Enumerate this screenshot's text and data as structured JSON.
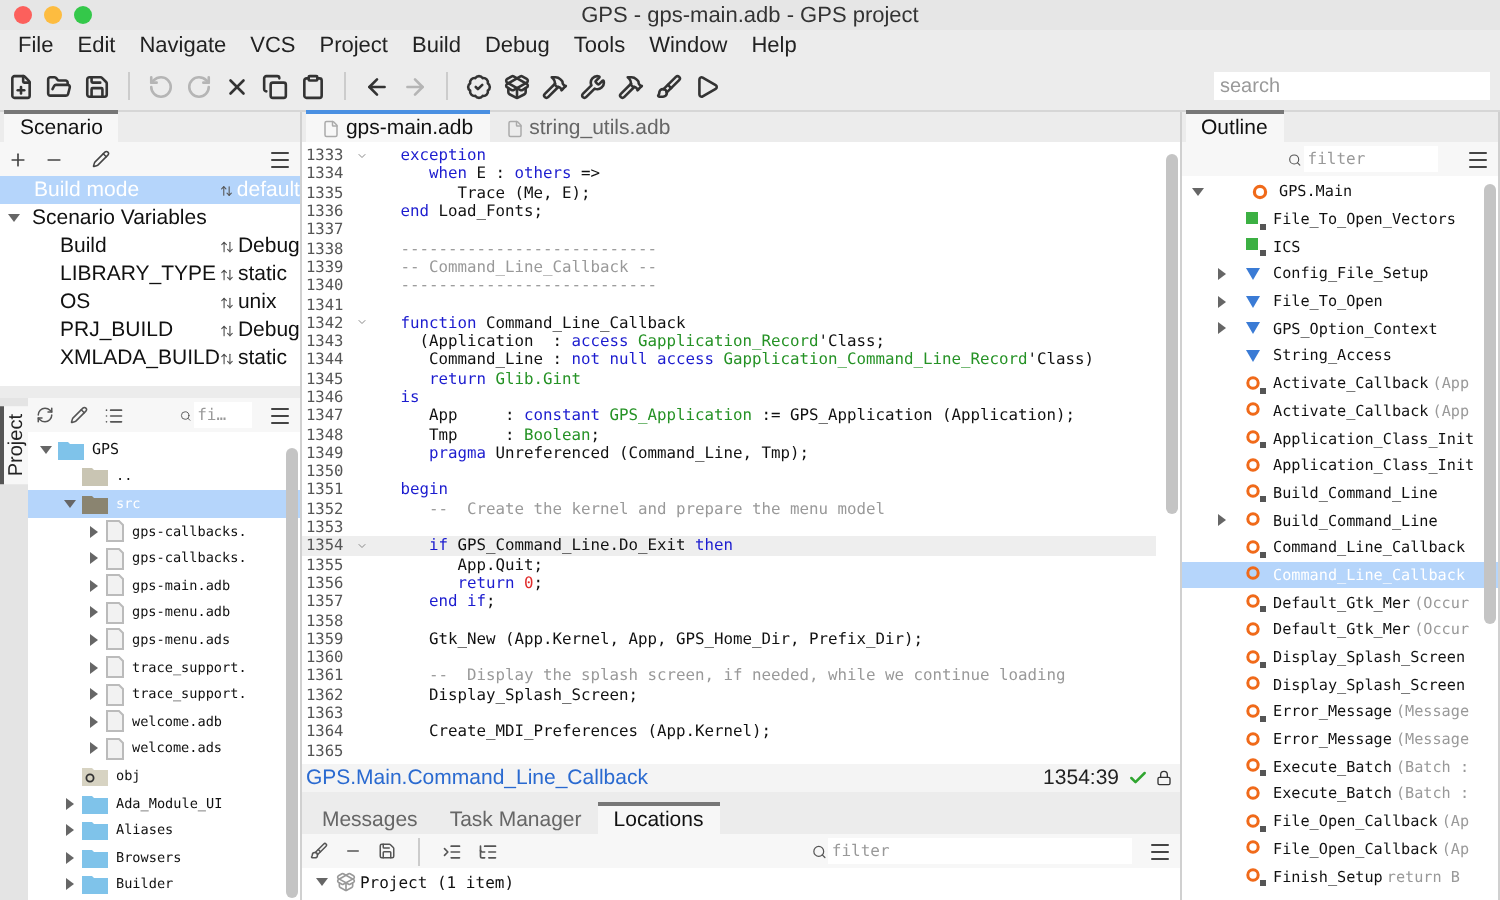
{
  "window": {
    "title": "GPS - gps-main.adb - GPS project"
  },
  "menu": [
    "File",
    "Edit",
    "Navigate",
    "VCS",
    "Project",
    "Build",
    "Debug",
    "Tools",
    "Window",
    "Help"
  ],
  "toolbar": {
    "buttons": [
      {
        "disabled": false
      },
      {
        "disabled": false
      },
      {
        "disabled": false
      },
      {
        "disabled": true
      },
      {
        "disabled": true
      },
      {
        "disabled": false
      },
      {
        "disabled": false
      },
      {
        "disabled": false
      },
      {
        "disabled": false
      },
      {
        "disabled": true
      },
      {
        "disabled": false
      },
      {
        "disabled": false
      },
      {
        "disabled": false
      },
      {
        "disabled": false
      },
      {
        "disabled": false
      },
      {
        "disabled": false
      },
      {
        "disabled": false
      }
    ],
    "search": {
      "placeholder": "search"
    }
  },
  "scenario": {
    "tab": "Scenario",
    "build_mode": {
      "label": "Build mode",
      "value": "default",
      "selected": true
    },
    "group": {
      "label": "Scenario Variables",
      "expanded": true
    },
    "variables": [
      {
        "name": "Build",
        "value": "Debug"
      },
      {
        "name": "LIBRARY_TYPE",
        "value": "static"
      },
      {
        "name": "OS",
        "value": "unix"
      },
      {
        "name": "PRJ_BUILD",
        "value": "Debug"
      },
      {
        "name": "XMLADA_BUILD",
        "value": "static"
      }
    ]
  },
  "project": {
    "tab": "Project",
    "filter_placeholder": "fi…",
    "tree": [
      {
        "label": "GPS",
        "kind": "project",
        "expanded": true,
        "selected": false,
        "children": [
          {
            "label": "..",
            "kind": "parent",
            "selected": false
          },
          {
            "label": "src",
            "kind": "source",
            "expanded": true,
            "selected": true,
            "children": [
              {
                "label": "gps-callbacks.",
                "kind": "file",
                "expanded": false,
                "selected": false
              },
              {
                "label": "gps-callbacks.",
                "kind": "file",
                "expanded": false,
                "selected": false
              },
              {
                "label": "gps-main.adb",
                "kind": "file",
                "expanded": false,
                "selected": false
              },
              {
                "label": "gps-menu.adb",
                "kind": "file",
                "expanded": false,
                "selected": false
              },
              {
                "label": "gps-menu.ads",
                "kind": "file",
                "expanded": false,
                "selected": false
              },
              {
                "label": "trace_support.",
                "kind": "file",
                "expanded": false,
                "selected": false
              },
              {
                "label": "trace_support.",
                "kind": "file",
                "expanded": false,
                "selected": false
              },
              {
                "label": "welcome.adb",
                "kind": "file",
                "expanded": false,
                "selected": false
              },
              {
                "label": "welcome.ads",
                "kind": "file",
                "expanded": false,
                "selected": false
              }
            ]
          },
          {
            "label": "obj",
            "kind": "object",
            "selected": false
          },
          {
            "label": "Ada_Module_UI",
            "kind": "project",
            "expanded": false,
            "selected": false
          },
          {
            "label": "Aliases",
            "kind": "project",
            "expanded": false,
            "selected": false
          },
          {
            "label": "Browsers",
            "kind": "project",
            "expanded": false,
            "selected": false
          },
          {
            "label": "Builder",
            "kind": "project",
            "expanded": false,
            "selected": false
          }
        ]
      }
    ]
  },
  "editor": {
    "tabs": [
      {
        "label": "gps-main.adb",
        "selected": true
      },
      {
        "label": "string_utils.adb",
        "selected": false
      }
    ],
    "lines": [
      {
        "n": "1333",
        "fold": true,
        "current": false,
        "segs": [
          {
            "kind": "kw",
            "text": "   exception"
          }
        ]
      },
      {
        "n": "1334",
        "fold": false,
        "current": false,
        "segs": [
          {
            "kind": "kw",
            "text": "      when"
          },
          {
            "kind": "plain",
            "text": " E : "
          },
          {
            "kind": "kw",
            "text": "others"
          },
          {
            "kind": "plain",
            "text": " =>"
          }
        ]
      },
      {
        "n": "1335",
        "fold": false,
        "current": false,
        "segs": [
          {
            "kind": "plain",
            "text": "         Trace (Me, E);"
          }
        ]
      },
      {
        "n": "1336",
        "fold": false,
        "current": false,
        "segs": [
          {
            "kind": "kw",
            "text": "   end"
          },
          {
            "kind": "plain",
            "text": " Load_Fonts;"
          }
        ]
      },
      {
        "n": "1337",
        "fold": false,
        "current": false
      },
      {
        "n": "1338",
        "fold": false,
        "current": false,
        "segs": [
          {
            "kind": "comment",
            "text": "   ---------------------------"
          }
        ]
      },
      {
        "n": "1339",
        "fold": false,
        "current": false,
        "segs": [
          {
            "kind": "comment",
            "text": "   -- Command_Line_Callback --"
          }
        ]
      },
      {
        "n": "1340",
        "fold": false,
        "current": false,
        "segs": [
          {
            "kind": "comment",
            "text": "   ---------------------------"
          }
        ]
      },
      {
        "n": "1341",
        "fold": false,
        "current": false
      },
      {
        "n": "1342",
        "fold": true,
        "current": false,
        "segs": [
          {
            "kind": "kw",
            "text": "   function"
          },
          {
            "kind": "plain",
            "text": " Command_Line_Callback"
          }
        ]
      },
      {
        "n": "1343",
        "fold": false,
        "current": false,
        "segs": [
          {
            "kind": "plain",
            "text": "     (Application  : "
          },
          {
            "kind": "kw",
            "text": "access "
          },
          {
            "kind": "type",
            "text": "Gapplication_Record"
          },
          {
            "kind": "plain",
            "text": "'Class;"
          }
        ]
      },
      {
        "n": "1344",
        "fold": false,
        "current": false,
        "segs": [
          {
            "kind": "plain",
            "text": "      Command_Line : "
          },
          {
            "kind": "kw",
            "text": "not null access "
          },
          {
            "kind": "type",
            "text": "Gapplication_Command_Line_Record"
          },
          {
            "kind": "plain",
            "text": "'Class)"
          }
        ]
      },
      {
        "n": "1345",
        "fold": false,
        "current": false,
        "segs": [
          {
            "kind": "kw",
            "text": "      return "
          },
          {
            "kind": "type",
            "text": "Glib.Gint"
          }
        ]
      },
      {
        "n": "1346",
        "fold": false,
        "current": false,
        "segs": [
          {
            "kind": "kw",
            "text": "   is"
          }
        ]
      },
      {
        "n": "1347",
        "fold": false,
        "current": false,
        "segs": [
          {
            "kind": "plain",
            "text": "      App     : "
          },
          {
            "kind": "kw",
            "text": "constant "
          },
          {
            "kind": "type",
            "text": "GPS_Application"
          },
          {
            "kind": "plain",
            "text": " := GPS_Application (Application);"
          }
        ]
      },
      {
        "n": "1348",
        "fold": false,
        "current": false,
        "segs": [
          {
            "kind": "plain",
            "text": "      Tmp     : "
          },
          {
            "kind": "type",
            "text": "Boolean"
          },
          {
            "kind": "plain",
            "text": ";"
          }
        ]
      },
      {
        "n": "1349",
        "fold": false,
        "current": false,
        "segs": [
          {
            "kind": "kw",
            "text": "      pragma"
          },
          {
            "kind": "plain",
            "text": " Unreferenced (Command_Line, Tmp);"
          }
        ]
      },
      {
        "n": "1350",
        "fold": false,
        "current": false
      },
      {
        "n": "1351",
        "fold": false,
        "current": false,
        "segs": [
          {
            "kind": "kw",
            "text": "   begin"
          }
        ]
      },
      {
        "n": "1352",
        "fold": false,
        "current": false,
        "segs": [
          {
            "kind": "comment",
            "text": "      --  Create the kernel and prepare the menu model"
          }
        ]
      },
      {
        "n": "1353",
        "fold": false,
        "current": false
      },
      {
        "n": "1354",
        "fold": true,
        "current": true,
        "segs": [
          {
            "kind": "kw",
            "text": "      if"
          },
          {
            "kind": "plain",
            "text": " GPS_Command_Line.Do_Exit "
          },
          {
            "kind": "kw",
            "text": "then"
          }
        ]
      },
      {
        "n": "1355",
        "fold": false,
        "current": false,
        "segs": [
          {
            "kind": "plain",
            "text": "         App.Quit;"
          }
        ]
      },
      {
        "n": "1356",
        "fold": false,
        "current": false,
        "segs": [
          {
            "kind": "kw",
            "text": "         return "
          },
          {
            "kind": "num",
            "text": "0"
          },
          {
            "kind": "plain",
            "text": ";"
          }
        ]
      },
      {
        "n": "1357",
        "fold": false,
        "current": false,
        "segs": [
          {
            "kind": "kw",
            "text": "      end if"
          },
          {
            "kind": "plain",
            "text": ";"
          }
        ]
      },
      {
        "n": "1358",
        "fold": false,
        "current": false
      },
      {
        "n": "1359",
        "fold": false,
        "current": false,
        "segs": [
          {
            "kind": "plain",
            "text": "      Gtk_New (App.Kernel, App, GPS_Home_Dir, Prefix_Dir);"
          }
        ]
      },
      {
        "n": "1360",
        "fold": false,
        "current": false
      },
      {
        "n": "1361",
        "fold": false,
        "current": false,
        "segs": [
          {
            "kind": "comment",
            "text": "      --  Display the splash screen, if needed, while we continue loading"
          }
        ]
      },
      {
        "n": "1362",
        "fold": false,
        "current": false,
        "segs": [
          {
            "kind": "plain",
            "text": "      Display_Splash_Screen;"
          }
        ]
      },
      {
        "n": "1363",
        "fold": false,
        "current": false
      },
      {
        "n": "1364",
        "fold": false,
        "current": false,
        "segs": [
          {
            "kind": "plain",
            "text": "      Create_MDI_Preferences (App.Kernel);"
          }
        ]
      },
      {
        "n": "1365",
        "fold": false,
        "current": false
      }
    ],
    "breadcrumb": "GPS.Main.Command_Line_Callback",
    "cursor": "1354:39"
  },
  "bottom": {
    "tabs": [
      {
        "label": "Messages",
        "selected": false
      },
      {
        "label": "Task Manager",
        "selected": false
      },
      {
        "label": "Locations",
        "selected": true
      }
    ],
    "filter_placeholder": "filter",
    "tree": [
      {
        "label": "Project (1 item)",
        "expanded": true
      }
    ]
  },
  "outline": {
    "tab": "Outline",
    "filter_placeholder": "filter",
    "items": [
      {
        "name": "GPS.Main",
        "kind": "package",
        "spec": false,
        "expanded": true,
        "selected": false,
        "children": [
          {
            "name": "File_To_Open_Vectors",
            "kind": "variable",
            "spec": true,
            "selected": false
          },
          {
            "name": "ICS",
            "kind": "variable",
            "spec": true,
            "selected": false
          },
          {
            "name": "Config_File_Setup",
            "kind": "type",
            "spec": false,
            "expanded": false,
            "selected": false
          },
          {
            "name": "File_To_Open",
            "kind": "type",
            "spec": false,
            "expanded": false,
            "selected": false
          },
          {
            "name": "GPS_Option_Context",
            "kind": "type",
            "spec": false,
            "expanded": false,
            "selected": false
          },
          {
            "name": "String_Access",
            "kind": "type",
            "spec": false,
            "selected": false
          },
          {
            "name": "Activate_Callback",
            "detail": "(App",
            "kind": "subprogram",
            "spec": true,
            "selected": false
          },
          {
            "name": "Activate_Callback",
            "detail": "(App",
            "kind": "subprogram",
            "spec": false,
            "selected": false
          },
          {
            "name": "Application_Class_Init",
            "kind": "subprogram",
            "spec": true,
            "selected": false
          },
          {
            "name": "Application_Class_Init",
            "kind": "subprogram",
            "spec": false,
            "selected": false
          },
          {
            "name": "Build_Command_Line",
            "kind": "subprogram",
            "spec": true,
            "selected": false
          },
          {
            "name": "Build_Command_Line",
            "kind": "subprogram",
            "spec": false,
            "expanded": false,
            "selected": false
          },
          {
            "name": "Command_Line_Callback",
            "kind": "subprogram",
            "spec": true,
            "selected": false
          },
          {
            "name": "Command_Line_Callback",
            "kind": "subprogram",
            "spec": false,
            "selected": true
          },
          {
            "name": "Default_Gtk_Mer",
            "detail": "(Occur",
            "kind": "subprogram",
            "spec": true,
            "selected": false
          },
          {
            "name": "Default_Gtk_Mer",
            "detail": "(Occur",
            "kind": "subprogram",
            "spec": false,
            "selected": false
          },
          {
            "name": "Display_Splash_Screen",
            "kind": "subprogram",
            "spec": true,
            "selected": false
          },
          {
            "name": "Display_Splash_Screen",
            "kind": "subprogram",
            "spec": false,
            "selected": false
          },
          {
            "name": "Error_Message",
            "detail": "(Message",
            "kind": "subprogram",
            "spec": true,
            "selected": false
          },
          {
            "name": "Error_Message",
            "detail": "(Message",
            "kind": "subprogram",
            "spec": false,
            "selected": false
          },
          {
            "name": "Execute_Batch",
            "detail": "(Batch :",
            "kind": "subprogram",
            "spec": true,
            "selected": false
          },
          {
            "name": "Execute_Batch",
            "detail": "(Batch :",
            "kind": "subprogram",
            "spec": false,
            "selected": false
          },
          {
            "name": "File_Open_Callback",
            "detail": "(Ap",
            "kind": "subprogram",
            "spec": true,
            "selected": false
          },
          {
            "name": "File_Open_Callback",
            "detail": "(Ap",
            "kind": "subprogram",
            "spec": false,
            "selected": false
          },
          {
            "name": "Finish_Setup",
            "detail": "return B",
            "kind": "subprogram",
            "spec": true,
            "selected": false
          }
        ]
      }
    ]
  }
}
